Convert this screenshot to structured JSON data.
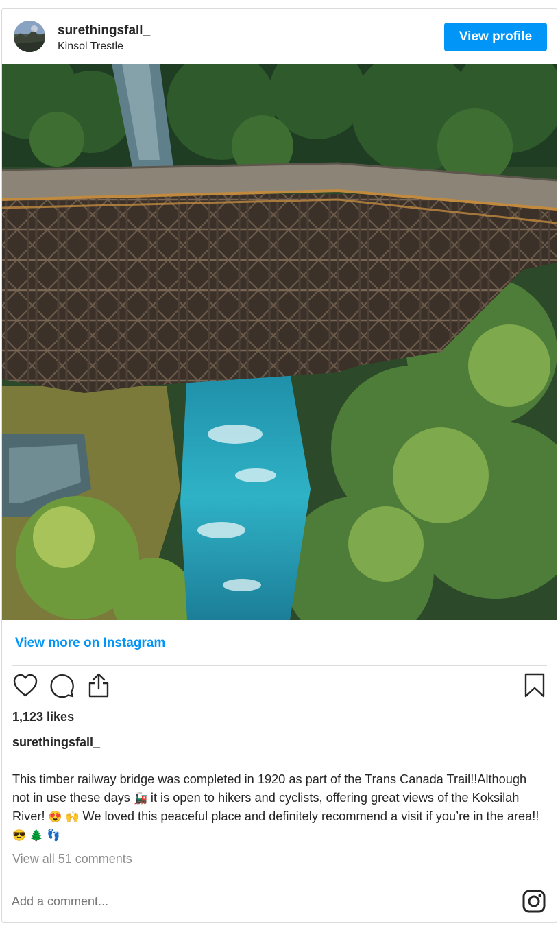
{
  "header": {
    "username": "surethingsfall_",
    "location": "Kinsol Trestle",
    "view_profile_label": "View profile",
    "avatar_icon": "avatar-photo"
  },
  "photo": {
    "alt_subject": "timber railway trestle over turquoise river"
  },
  "links": {
    "view_more": "View more on Instagram"
  },
  "actions": {
    "like_icon": "heart-icon",
    "comment_icon": "comment-icon",
    "share_icon": "share-icon",
    "save_icon": "bookmark-icon"
  },
  "post": {
    "likes": "1,123 likes",
    "caption_user": "surethingsfall_",
    "caption_part1": "This timber railway bridge was completed in 1920 as part of the Trans Canada Trail!!Although not in use these days ",
    "emoji_train": "🚂",
    "caption_part2": " it is open to hikers and cyclists, offering great views of the Koksilah River! ",
    "emoji_hearteyes": "😍",
    "emoji_hands": "🙌",
    "caption_part3": " We loved this peaceful place and definitely recommend a visit if you’re in the area!! ",
    "emoji_sunglasses": "😎",
    "emoji_tree": "🌲",
    "emoji_feet": "👣",
    "view_all_comments": "View all 51 comments"
  },
  "comment_box": {
    "placeholder": "Add a comment..."
  },
  "colors": {
    "brand_blue": "#0095f6",
    "text": "#262626",
    "muted": "#8e8e8e",
    "border": "#dbdbdb"
  }
}
